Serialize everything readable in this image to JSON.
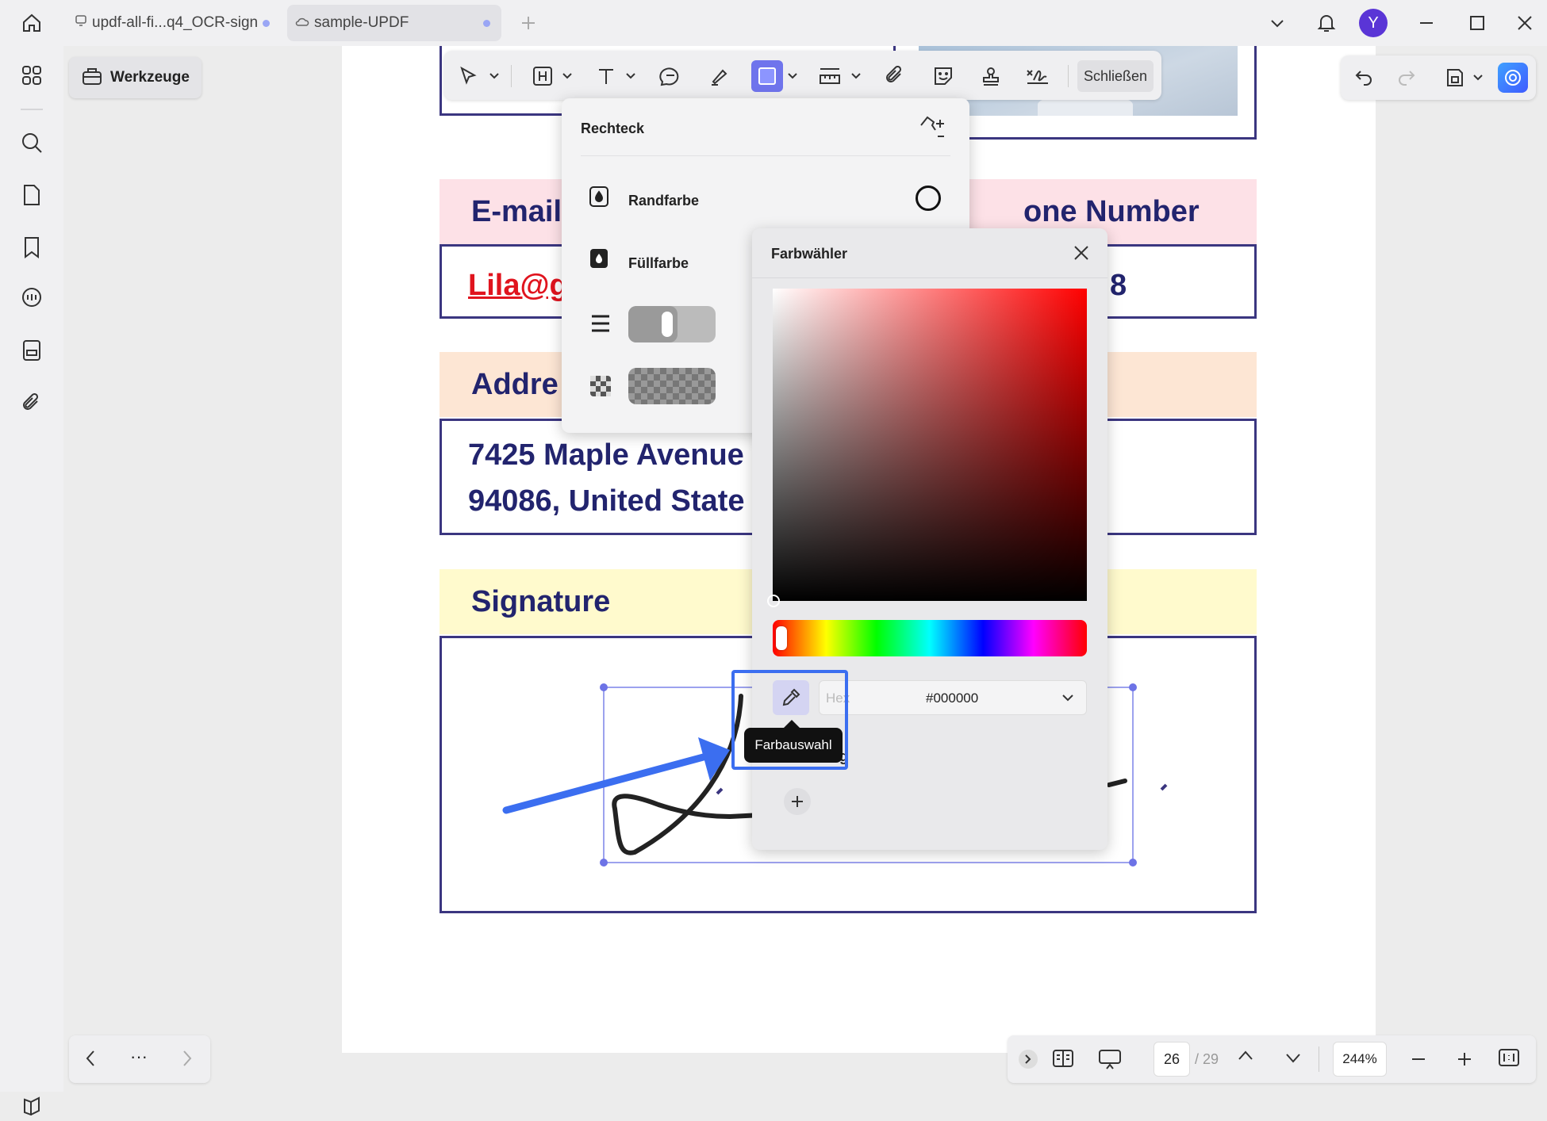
{
  "tabs": [
    {
      "label": "updf-all-fi...q4_OCR-sign"
    },
    {
      "label": "sample-UPDF"
    }
  ],
  "user": {
    "avatar_letter": "Y"
  },
  "tools": {
    "werkzeuge_label": "Werkzeuge"
  },
  "toolbar": {
    "close_label": "Schließen"
  },
  "document": {
    "email_heading": "E-mail",
    "phone_heading": "one Number",
    "email_value": "Lila@g",
    "phone_value": "8",
    "address_heading": "Addre",
    "address_line1": "7425 Maple Avenue",
    "address_line2": "94086, United State",
    "signature_heading": "Signature"
  },
  "rect_panel": {
    "title": "Rechteck",
    "border_label": "Randfarbe",
    "fill_label": "Füllfarbe"
  },
  "color_picker": {
    "title": "Farbwähler",
    "hex_placeholder": "Hex",
    "hex_value": "#000000",
    "tooltip": "Farbauswahl",
    "partial_label": "ung",
    "selected_hue": "#ff0000"
  },
  "footer": {
    "current_page": "26",
    "total_pages": "/ 29",
    "zoom": "244%",
    "more": "···"
  },
  "colors": {
    "accent": "#5b6af2",
    "annotation_arrow": "#3b6ef0"
  }
}
